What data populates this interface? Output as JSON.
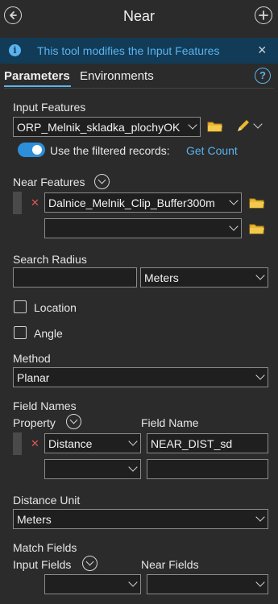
{
  "header": {
    "title": "Near",
    "back_icon": "back-arrow-icon",
    "add_icon": "plus-icon"
  },
  "banner": {
    "text": "This tool modifies the Input Features",
    "close": "×"
  },
  "tabs": [
    {
      "label": "Parameters",
      "active": true
    },
    {
      "label": "Environments",
      "active": false
    }
  ],
  "help": "?",
  "input_features": {
    "label": "Input Features",
    "value": "ORP_Melnik_skladka_plochyOK",
    "filtered_label": "Use the filtered records:",
    "get_count": "Get Count"
  },
  "near_features": {
    "label": "Near Features",
    "rows": [
      {
        "value": "Dalnice_Melnik_Clip_Buffer300m"
      },
      {
        "value": ""
      }
    ]
  },
  "search_radius": {
    "label": "Search Radius",
    "value": "",
    "unit": "Meters"
  },
  "location": {
    "label": "Location",
    "checked": false
  },
  "angle": {
    "label": "Angle",
    "checked": false
  },
  "method": {
    "label": "Method",
    "value": "Planar"
  },
  "field_names": {
    "label": "Field Names",
    "property_header": "Property",
    "field_name_header": "Field Name",
    "rows": [
      {
        "property": "Distance",
        "field_name": "NEAR_DIST_sd"
      },
      {
        "property": "",
        "field_name": ""
      }
    ]
  },
  "distance_unit": {
    "label": "Distance Unit",
    "value": "Meters"
  },
  "match_fields": {
    "label": "Match Fields",
    "input_header": "Input Fields",
    "near_header": "Near Fields",
    "rows": [
      {
        "input": "",
        "near": ""
      }
    ]
  },
  "colors": {
    "accent": "#5ab3ee",
    "background": "#2b2b2b",
    "banner": "#123b57",
    "delete": "#e05555",
    "folder": "#e8b830"
  }
}
